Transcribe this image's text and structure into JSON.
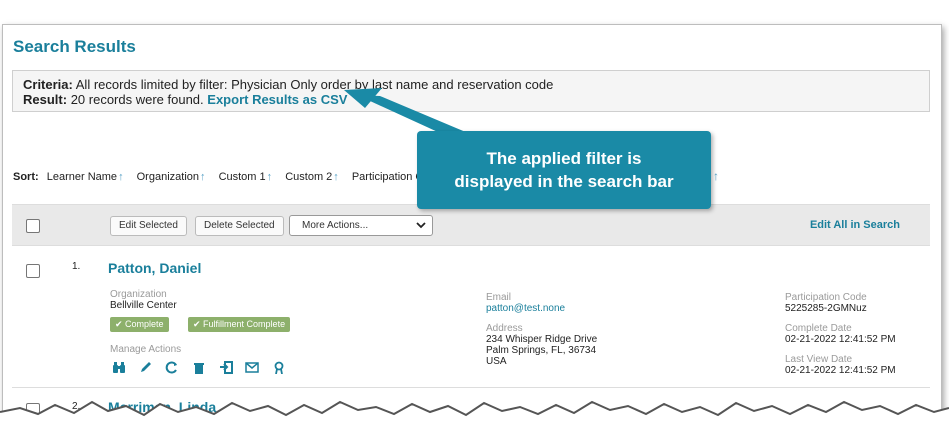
{
  "page": {
    "title": "Search Results",
    "criteria_label": "Criteria:",
    "criteria_text": "All records limited by filter: Physician Only order by last name and reservation code",
    "result_label": "Result:",
    "result_text": "20 records were found.",
    "export_link": "Export Results as CSV"
  },
  "sort": {
    "label": "Sort:",
    "items": [
      "Learner Name",
      "Organization",
      "Custom 1",
      "Custom 2",
      "Participation C"
    ],
    "arrow": "↑"
  },
  "toolbar": {
    "edit_selected": "Edit Selected",
    "delete_selected": "Delete Selected",
    "more_actions": "More Actions...",
    "edit_all": "Edit All in Search"
  },
  "records": [
    {
      "number": "1.",
      "name": "Patton, Daniel",
      "org_label": "Organization",
      "organization": "Bellville Center",
      "badges": [
        "✔ Complete",
        "✔ Fulfillment Complete"
      ],
      "manage_label": "Manage Actions",
      "email_label": "Email",
      "email": "patton@test.none",
      "address_label": "Address",
      "address_line1": "234 Whisper Ridge Drive",
      "address_line2": "Palm Springs, FL, 36734",
      "address_line3": "USA",
      "participation_label": "Participation Code",
      "participation_code": "5225285-2GMNuz",
      "complete_label": "Complete Date",
      "complete_date": "02-21-2022 12:41:52 PM",
      "lastview_label": "Last View Date",
      "lastview_date": "02-21-2022 12:41:52 PM"
    },
    {
      "number": "2.",
      "name": "Merriman, Linda"
    }
  ],
  "icons": [
    "binoculars-icon",
    "pencil-icon",
    "refresh-icon",
    "trash-icon",
    "sign-in-icon",
    "envelope-icon",
    "certificate-icon"
  ],
  "callout": {
    "line1": "The applied filter is",
    "line2": "displayed in the search bar"
  },
  "colors": {
    "accent": "#1a7f9b",
    "callout": "#1a8aa6",
    "badge": "#8db06b"
  }
}
